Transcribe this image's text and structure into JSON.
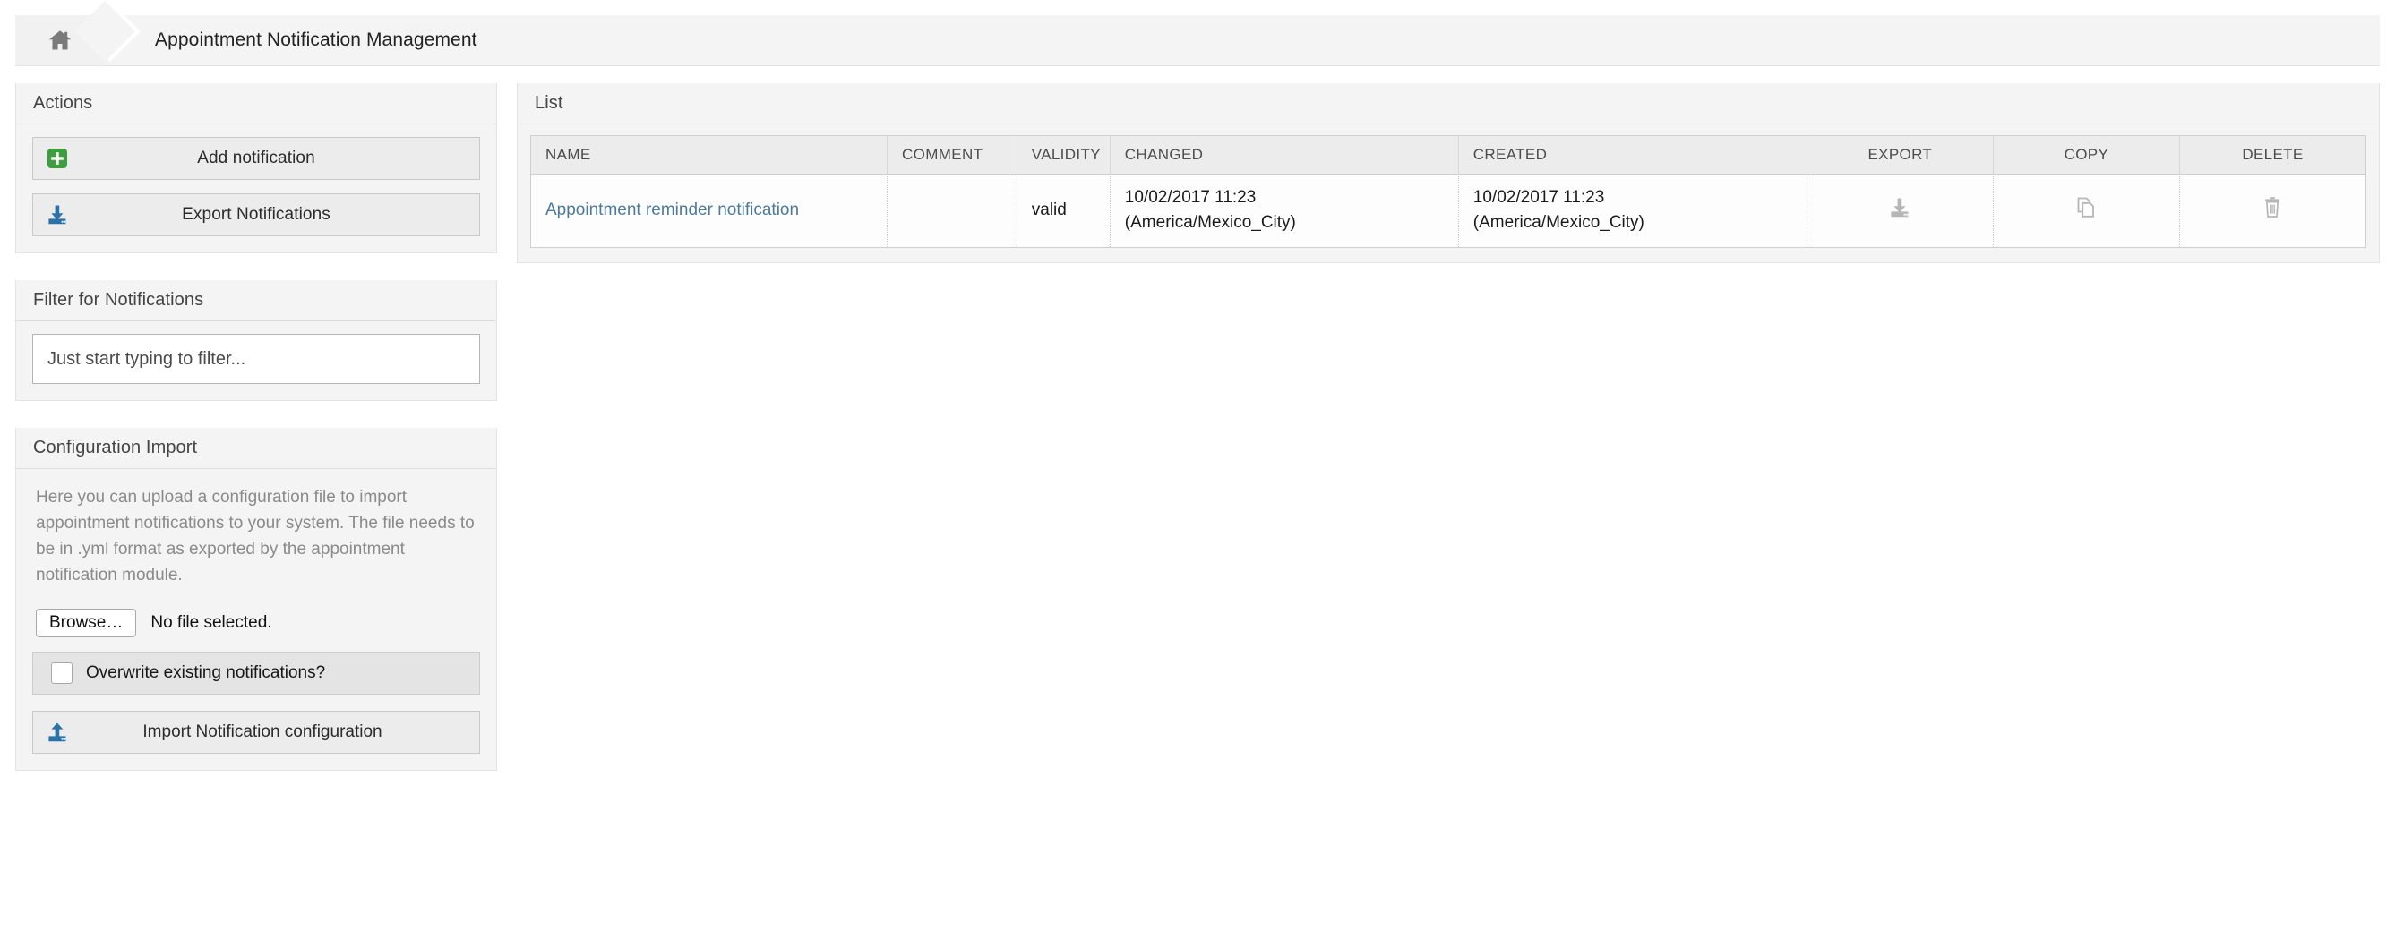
{
  "breadcrumb": {
    "home_icon": "home-icon",
    "title": "Appointment Notification Management"
  },
  "sidebar": {
    "actions": {
      "title": "Actions",
      "buttons": [
        {
          "label": "Add notification",
          "icon": "plus-square-icon",
          "icon_color": "#3c9e3c"
        },
        {
          "label": "Export Notifications",
          "icon": "download-icon",
          "icon_color": "#2a72a8"
        }
      ]
    },
    "filter": {
      "title": "Filter for Notifications",
      "placeholder": "Just start typing to filter...",
      "value": ""
    },
    "config_import": {
      "title": "Configuration Import",
      "description": "Here you can upload a configuration file to import appointment notifications to your system. The file needs to be in .yml format as exported by the appointment notification module.",
      "browse_label": "Browse…",
      "file_status": "No file selected.",
      "overwrite_label": "Overwrite existing notifications?",
      "overwrite_checked": false,
      "import_label": "Import Notification configuration",
      "import_icon": "upload-icon",
      "import_icon_color": "#2a72a8"
    }
  },
  "main": {
    "list": {
      "title": "List",
      "columns": [
        {
          "key": "name",
          "label": "NAME",
          "align": "left",
          "width": "17.6%"
        },
        {
          "key": "comment",
          "label": "COMMENT",
          "align": "left",
          "width": "6.4%"
        },
        {
          "key": "validity",
          "label": "VALIDITY",
          "align": "left",
          "width": "4.6%"
        },
        {
          "key": "changed",
          "label": "CHANGED",
          "align": "left",
          "width": "17.2%"
        },
        {
          "key": "created",
          "label": "CREATED",
          "align": "left",
          "width": "17.2%"
        },
        {
          "key": "export",
          "label": "EXPORT",
          "align": "center",
          "width": "9.2%"
        },
        {
          "key": "copy",
          "label": "COPY",
          "align": "center",
          "width": "9.2%"
        },
        {
          "key": "delete",
          "label": "DELETE",
          "align": "center",
          "width": "9.2%"
        }
      ],
      "rows": [
        {
          "name": "Appointment reminder notification",
          "comment": "",
          "validity": "valid",
          "changed_date": "10/02/2017 11:23",
          "changed_tz": "(America/Mexico_City)",
          "created_date": "10/02/2017 11:23",
          "created_tz": "(America/Mexico_City)",
          "export_icon": "download-icon",
          "copy_icon": "copy-icon",
          "delete_icon": "trash-icon"
        }
      ]
    }
  },
  "colors": {
    "link": "#4d7a9b",
    "panel_bg": "#f4f4f4",
    "header_bg": "#ececec",
    "accent_green": "#3c9e3c",
    "accent_blue": "#2a72a8",
    "icon_grey": "#b6b6b6"
  }
}
